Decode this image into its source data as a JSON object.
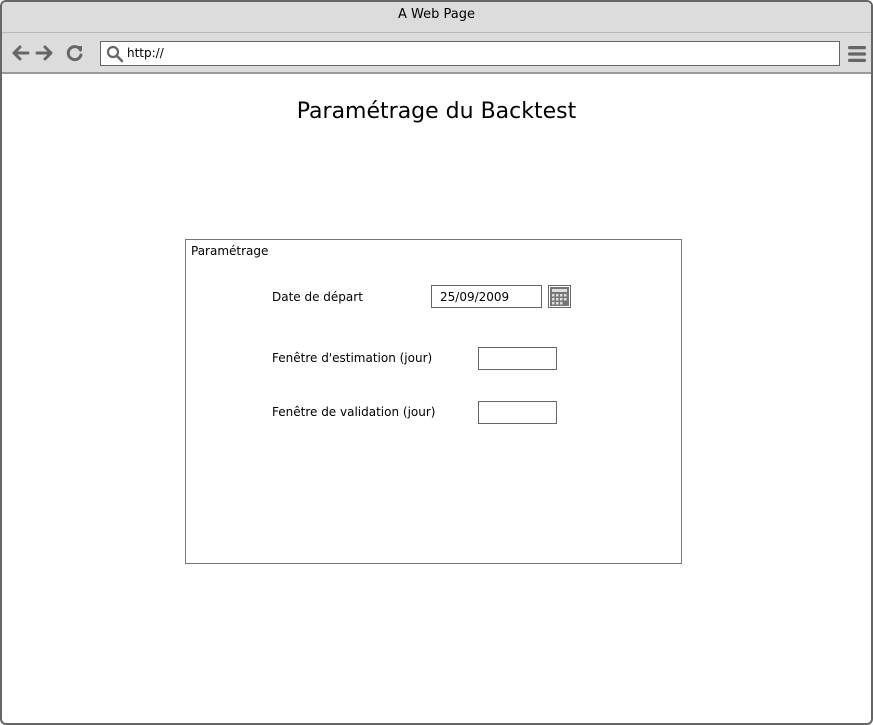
{
  "window": {
    "title": "A Web Page"
  },
  "toolbar": {
    "back_icon": "arrow-left-icon",
    "forward_icon": "arrow-right-icon",
    "reload_icon": "reload-icon",
    "search_icon": "search-icon",
    "menu_icon": "hamburger-menu-icon",
    "url": "http://"
  },
  "page": {
    "title": "Paramétrage du Backtest"
  },
  "panel": {
    "title": "Paramétrage",
    "fields": [
      {
        "label": "Date de départ",
        "value": "25/09/2009",
        "icon": "calendar-icon"
      },
      {
        "label": "Fenêtre d'estimation (jour)",
        "value": ""
      },
      {
        "label": "Fenêtre de validation (jour)",
        "value": ""
      }
    ]
  },
  "colors": {
    "chrome": "#dcdcdc",
    "border": "#666666",
    "icon": "#666666"
  }
}
